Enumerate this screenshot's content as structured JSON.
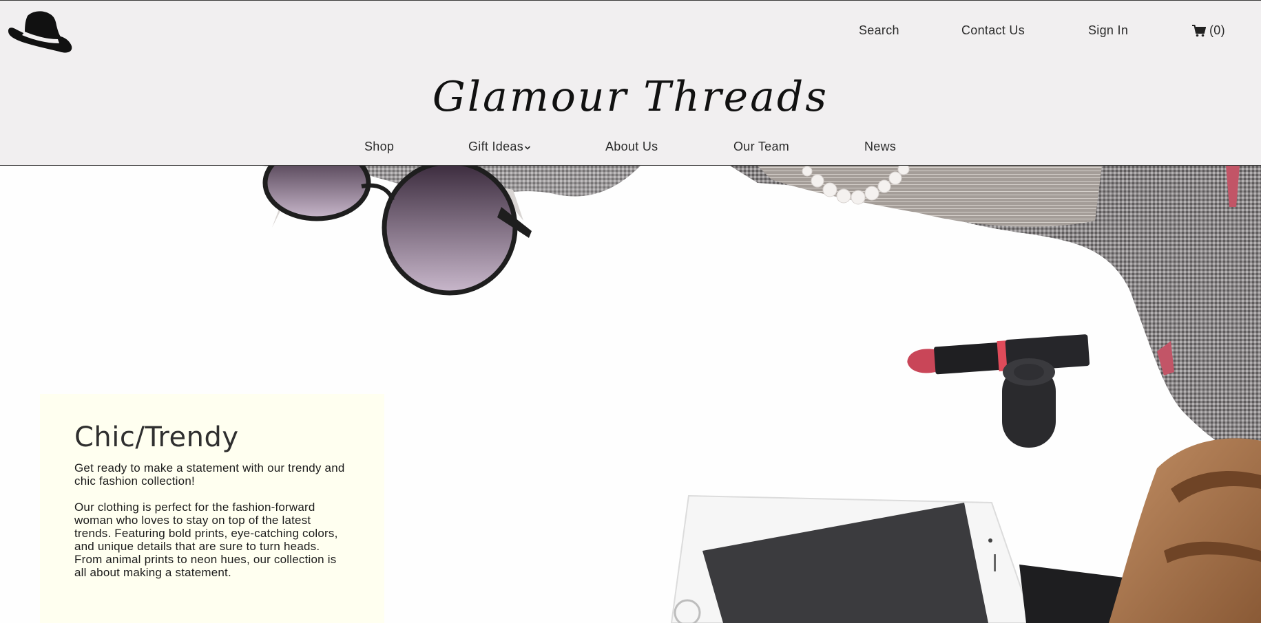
{
  "header": {
    "logo_icon": "fedora-hat-icon",
    "brand_name": "Glamour Threads",
    "top_links": {
      "search": "Search",
      "contact": "Contact Us",
      "sign_in": "Sign In",
      "cart_count": "(0)"
    },
    "main_nav": {
      "shop": "Shop",
      "gift_ideas": "Gift Ideas",
      "about": "About Us",
      "team": "Our Team",
      "news": "News"
    }
  },
  "hero": {
    "image_subject": "flat-lay-accessories-photo"
  },
  "promo": {
    "title": "Chic/Trendy",
    "paragraph_1": "Get ready to make a statement with our trendy and chic fashion collection!",
    "paragraph_2": "Our clothing is perfect for the fashion-forward woman who loves to stay on top of the latest trends. Featuring bold prints, eye-catching colors, and unique details that are sure to turn heads. From animal prints to neon hues, our collection is all about making a statement."
  },
  "colors": {
    "header_bg": "#f1eff0",
    "promo_bg": "#fffff0",
    "text": "#2b2b2b"
  }
}
